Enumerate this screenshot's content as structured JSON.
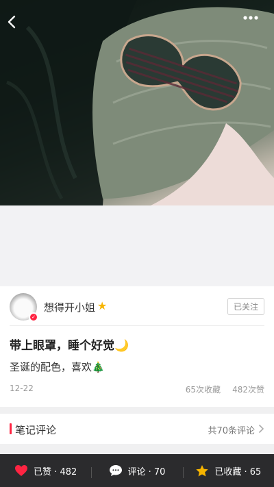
{
  "author": {
    "name": "想得开小姐"
  },
  "follow_label": "已关注",
  "note": {
    "title": "带上眼罩，睡个好觉🌙",
    "body": "圣诞的配色，喜欢🎄",
    "date": "12-22",
    "collect_count": "65次收藏",
    "view_count": "482次赞"
  },
  "comments": {
    "title": "笔记评论",
    "total": "共70条评论"
  },
  "bottom_bar": {
    "like": "已赞 · 482",
    "comment": "评论 · 70",
    "collect": "已收藏 · 65"
  },
  "colors": {
    "accent": "#ff2442",
    "bar": "#2b2b2d",
    "star": "#f7b500"
  },
  "icons": [
    "back-icon",
    "more-icon",
    "heart-icon",
    "comment-icon",
    "star-icon",
    "chevron-right-icon"
  ]
}
